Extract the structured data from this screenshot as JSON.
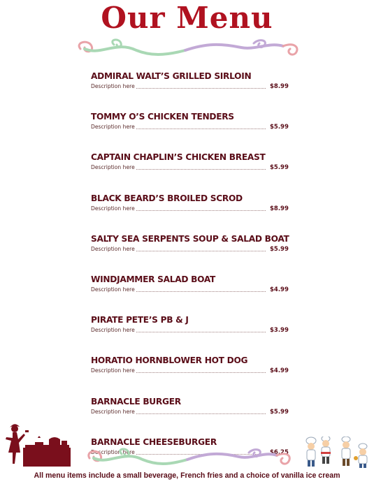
{
  "title": "Our Menu",
  "items": [
    {
      "name": "ADMIRAL WALT’S GRILLED SIRLOIN",
      "desc": "Description here",
      "price": "$8.99"
    },
    {
      "name": "TOMMY O’S CHICKEN TENDERS",
      "desc": "Description here",
      "price": "$5.99"
    },
    {
      "name": "CAPTAIN CHAPLIN’S CHICKEN BREAST",
      "desc": "Description here",
      "price": "$5.99"
    },
    {
      "name": "BLACK BEARD’S BROILED SCROD",
      "desc": "Description here",
      "price": "$8.99"
    },
    {
      "name": "SALTY SEA SERPENTS SOUP & SALAD BOAT",
      "desc": "Description here",
      "price": "$5.99"
    },
    {
      "name": "WINDJAMMER SALAD BOAT",
      "desc": "Description here",
      "price": "$4.99"
    },
    {
      "name": "PIRATE PETE’S PB & J",
      "desc": "Description here",
      "price": "$3.99"
    },
    {
      "name": "HORATIO HORNBLOWER HOT DOG",
      "desc": "Description here",
      "price": "$4.99"
    },
    {
      "name": "BARNACLE BURGER",
      "desc": "Description here",
      "price": "$5.99"
    },
    {
      "name": "BARNACLE CHEESEBURGER",
      "desc": "Description here",
      "price": "$6.25"
    }
  ],
  "footer": "All menu items include a small beverage, French fries and a choice of vanilla ice cream",
  "colors": {
    "title": "#b01220",
    "text": "#5a0d18",
    "swirl_pink": "#e9a3a8",
    "swirl_green": "#a9d8b4",
    "swirl_purple": "#c2a9d6"
  },
  "icons": [
    "swirl-divider-top",
    "swirl-divider-bottom",
    "cook-silhouette-icon",
    "chefs-illustration-icon"
  ]
}
